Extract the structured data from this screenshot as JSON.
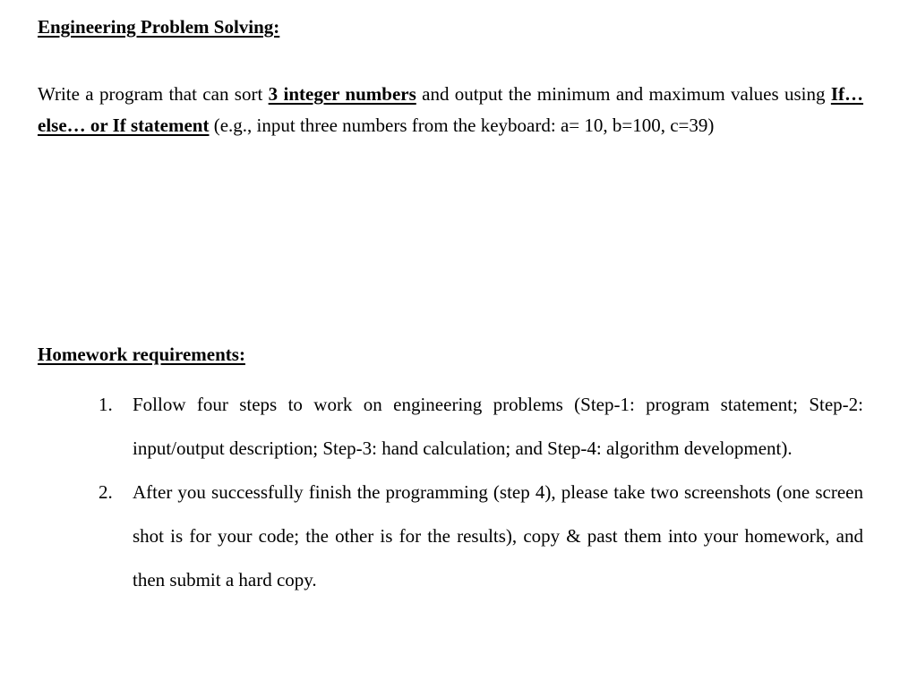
{
  "section1": {
    "heading": "Engineering Problem Solving:",
    "problem": {
      "part1": "Write a program that can sort ",
      "emphasis1": "3 integer numbers",
      "part2": " and output the minimum and maximum values using ",
      "emphasis2": "If…else… or If statement",
      "part3": " (e.g., input three numbers from the keyboard: a= 10, b=100, c=39)"
    }
  },
  "section2": {
    "heading": "Homework requirements:",
    "items": [
      {
        "number": "1.",
        "text": "Follow four steps to work on engineering problems (Step-1: program statement; Step-2: input/output description; Step-3: hand calculation; and Step-4: algorithm development)."
      },
      {
        "number": "2.",
        "text": "After you successfully finish the programming (step 4), please take two screenshots (one screen shot is for your code; the other is for the results), copy & past them into your homework, and then submit a hard copy."
      }
    ]
  }
}
